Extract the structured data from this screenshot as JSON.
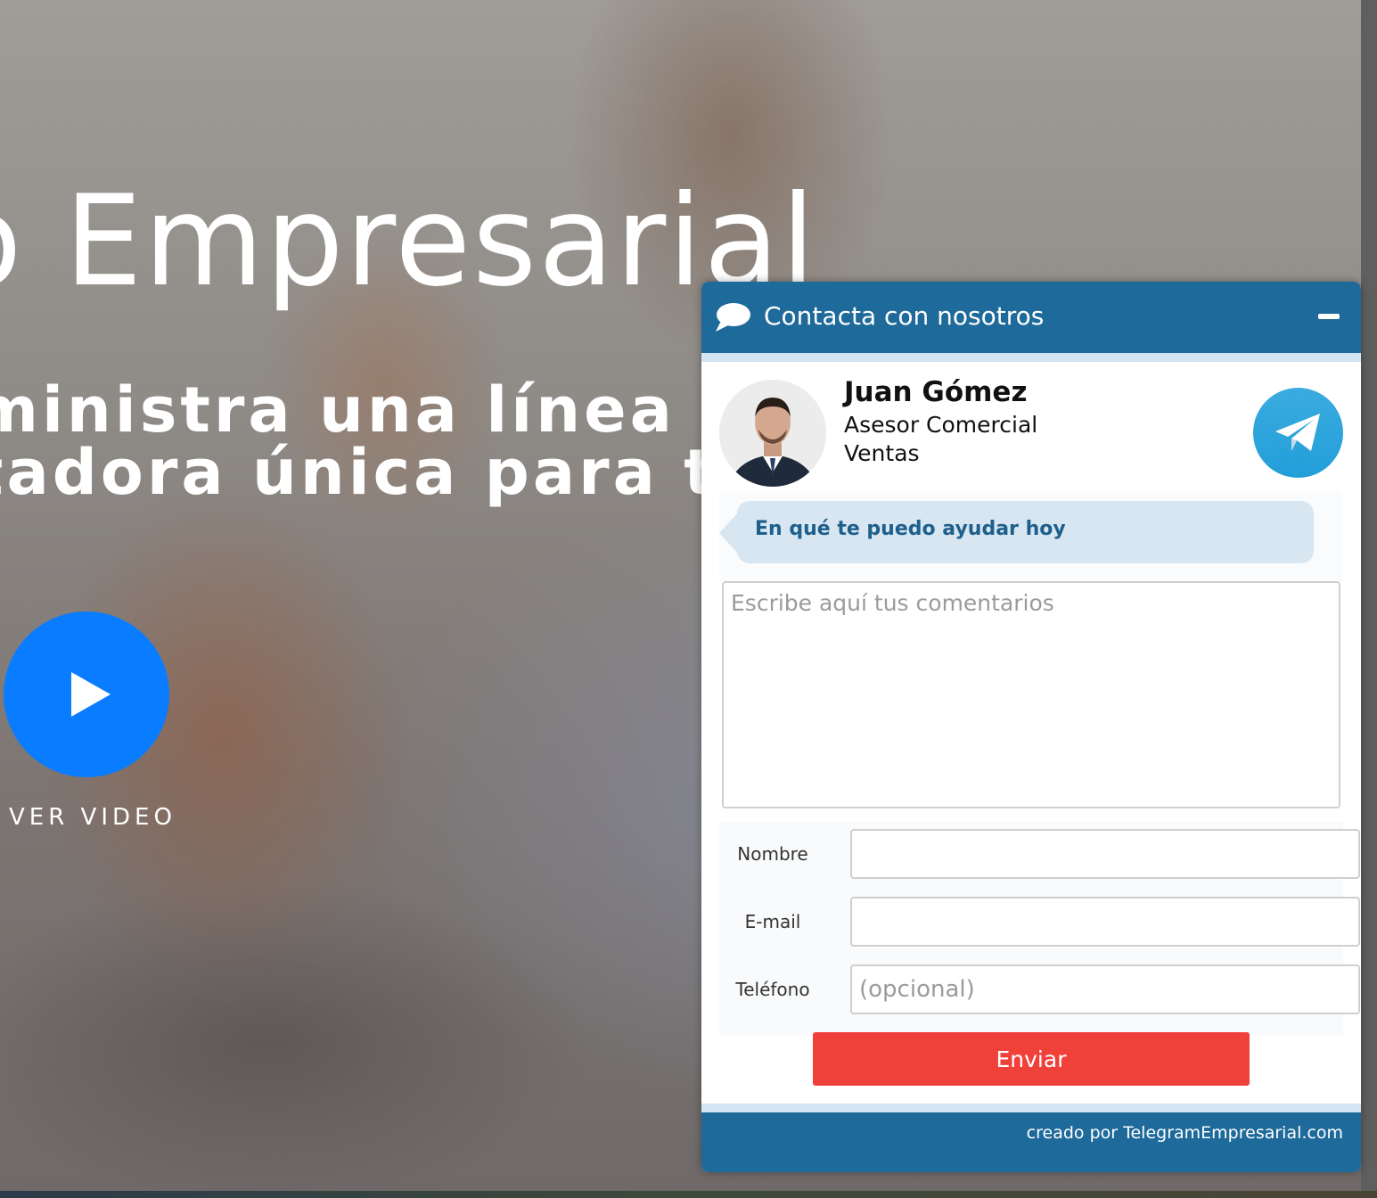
{
  "hero": {
    "title": "o Empresarial",
    "subtitle_line1": "ministra una línea telefó",
    "subtitle_line2": "tadora única para tu ne",
    "video_label": "VER VIDEO"
  },
  "widget": {
    "header_title": "Contacta con nosotros",
    "agent": {
      "name": "Juan Gómez",
      "role": "Asesor Comercial",
      "department": "Ventas"
    },
    "greeting": "En qué te puedo ayudar hoy",
    "comments_placeholder": "Escribe aquí tus comentarios",
    "fields": {
      "name_label": "Nombre",
      "email_label": "E-mail",
      "phone_label": "Teléfono",
      "phone_placeholder": "(opcional)"
    },
    "send_label": "Enviar",
    "credit": "creado por TelegramEmpresarial.com"
  },
  "colors": {
    "header_blue": "#1e6a9a",
    "send_red": "#f0403a",
    "play_blue": "#0a7cff",
    "telegram_blue": "#229ed9",
    "greeting_text": "#1e5f8c"
  },
  "icons": {
    "header": "chat-bubble-icon",
    "minimize": "minimize-icon",
    "telegram": "telegram-icon",
    "play": "play-icon"
  }
}
